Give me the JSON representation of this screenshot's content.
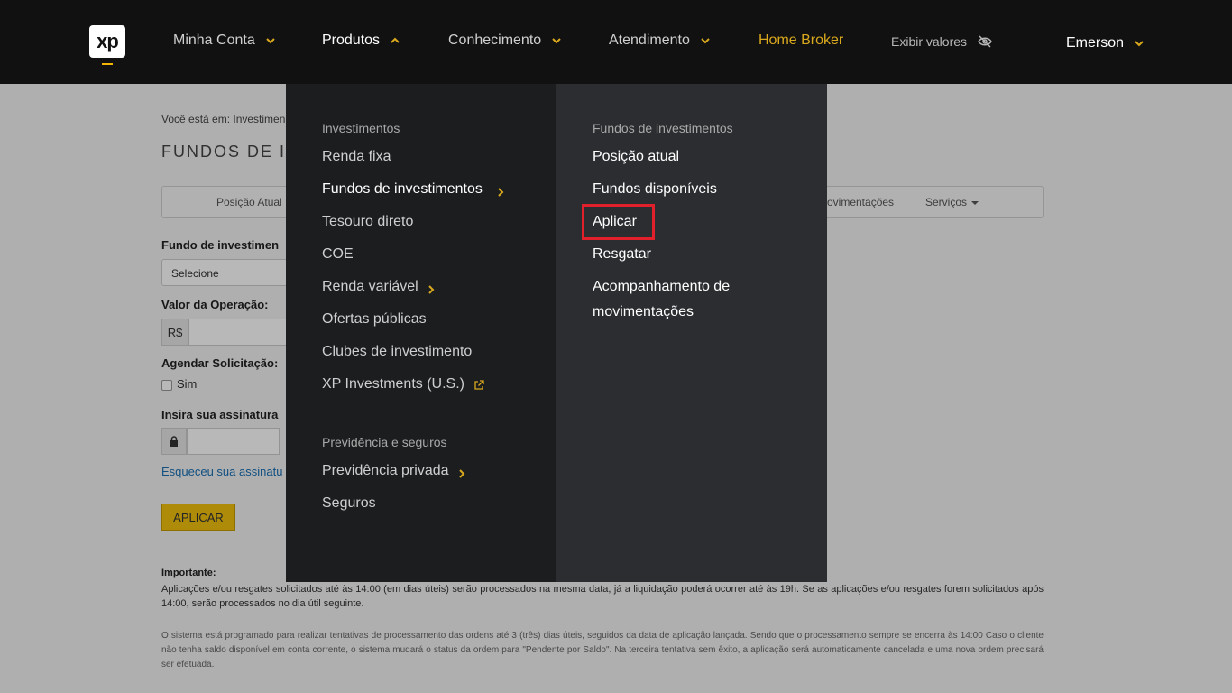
{
  "topnav": {
    "logo": "xp",
    "items": [
      {
        "label": "Minha Conta"
      },
      {
        "label": "Produtos"
      },
      {
        "label": "Conhecimento"
      },
      {
        "label": "Atendimento"
      },
      {
        "label": "Home Broker"
      }
    ],
    "show_values": "Exibir valores",
    "user": "Emerson"
  },
  "page": {
    "breadcrumb": "Você está em: Investimen",
    "title": "FUNDOS DE IN",
    "tabs": [
      "Posição Atual",
      "ovimentações",
      "Serviços"
    ],
    "fund_label": "Fundo de investimen",
    "select_value": "Selecione",
    "value_label": "Valor da Operação:",
    "currency": "R$",
    "schedule_label": "Agendar Solicitação:",
    "schedule_yes": "Sim",
    "signature_label": "Insira sua assinatura",
    "forgot_link": "Esqueceu sua assinatu",
    "apply_button": "APLICAR",
    "important_title": "Importante:",
    "important_text": "Aplicações e/ou resgates solicitados até às 14:00 (em dias úteis) serão processados na mesma data, já a liquidação poderá ocorrer até às 19h. Se as aplicações e/ou resgates forem solicitados após 14:00, serão processados no dia útil seguinte.",
    "system_text": "O sistema está programado para realizar tentativas de processamento das ordens até 3 (três) dias úteis, seguidos da data de aplicação lançada. Sendo que o processamento sempre se encerra às 14:00 Caso o cliente não tenha saldo disponível em conta corrente, o sistema mudará o status da ordem para \"Pendente por Saldo\". Na terceira tentativa sem êxito, a aplicação será automaticamente cancelada e uma nova ordem precisará ser efetuada."
  },
  "menu": {
    "left": {
      "heading1": "Investimentos",
      "items1": [
        "Renda fixa",
        "Fundos de investimentos",
        "Tesouro direto",
        "COE",
        "Renda variável",
        "Ofertas públicas",
        "Clubes de investimento",
        "XP Investments (U.S.)"
      ],
      "heading2": "Previdência e seguros",
      "items2": [
        "Previdência privada",
        "Seguros"
      ]
    },
    "right": {
      "heading": "Fundos de investimentos",
      "items": [
        "Posição atual",
        "Fundos disponíveis",
        "Aplicar",
        "Resgatar",
        "Acompanhamento de",
        "movimentações"
      ]
    }
  },
  "colors": {
    "accent": "#f2b705",
    "highlight": "#e2202b",
    "menu_dark": "#1c1d1f",
    "menu_panel": "#2c2d30"
  }
}
